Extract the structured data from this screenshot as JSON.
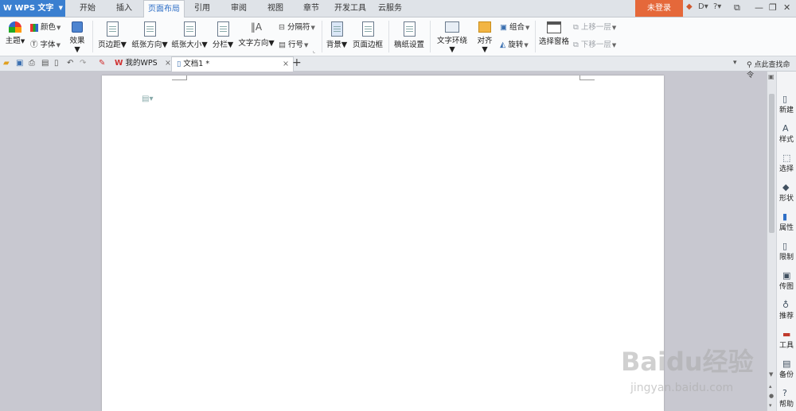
{
  "app": {
    "name": "WPS 文字",
    "logo": "W"
  },
  "menu": {
    "tabs": [
      "开始",
      "插入",
      "页面布局",
      "引用",
      "审阅",
      "视图",
      "章节",
      "开发工具",
      "云服务"
    ],
    "active_tab": "页面布局"
  },
  "login_label": "未登录",
  "ribbon": {
    "theme": "主题",
    "color": "颜色",
    "font": "字体",
    "effect": "效果",
    "margins": "页边距",
    "orientation": "纸张方向",
    "size": "纸张大小",
    "columns": "分栏",
    "text_direction": "文字方向",
    "break": "分隔符",
    "line_number": "行号",
    "background": "背景",
    "page_border": "页面边框",
    "paper_setup": "稿纸设置",
    "wrap_text": "文字环绕",
    "align": "对齐",
    "group": "组合",
    "rotate": "旋转",
    "selection_pane": "选择窗格",
    "bring_forward": "上移一层",
    "send_backward": "下移一层"
  },
  "doc_tabs": [
    {
      "label": "我的WPS"
    },
    {
      "label": "文档1 *"
    }
  ],
  "search_placeholder": "点此查找命令",
  "side_panel": [
    "新建",
    "样式",
    "选择",
    "形状",
    "属性",
    "限制",
    "传图",
    "推荐",
    "工具",
    "备份",
    "帮助"
  ],
  "watermark": {
    "logo": "Baidu经验",
    "url": "jingyan.baidu.com"
  },
  "colors": {
    "accent": "#3a7fd0",
    "login": "#e5683a",
    "workspace": "#c8c8d0"
  }
}
